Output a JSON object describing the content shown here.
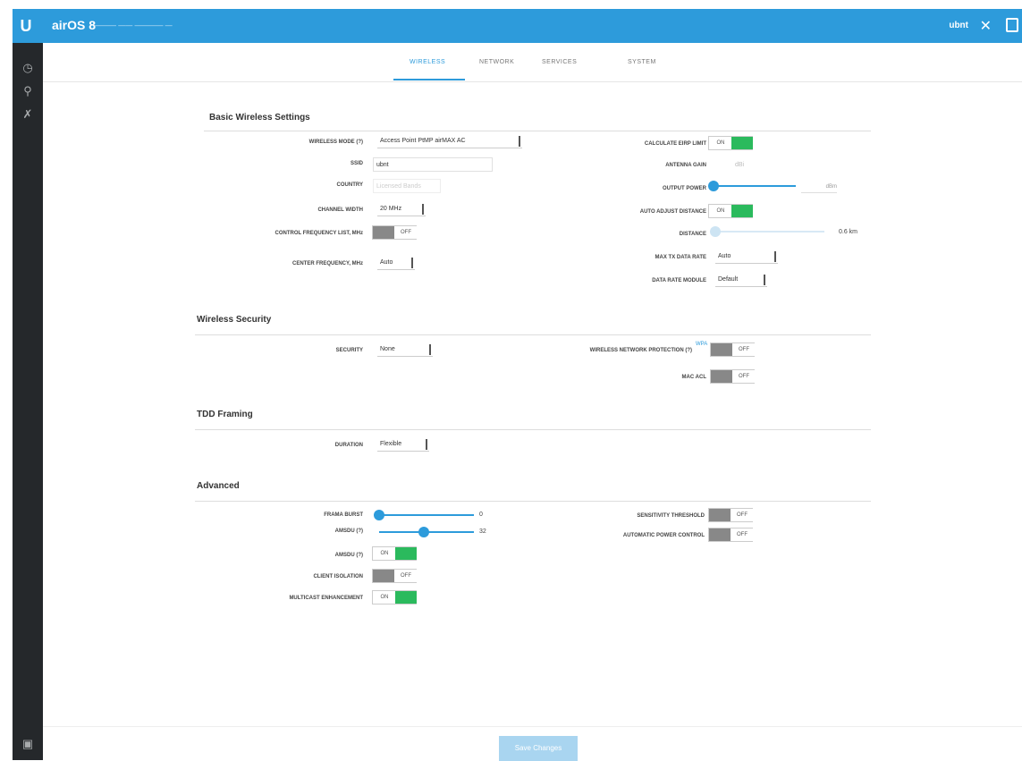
{
  "header": {
    "logo": "U",
    "brand": "airOS 8",
    "subtitle": "——— —— ———— —",
    "user": "ubnt",
    "tool_icon": "tools-icon",
    "logout_icon": "logout-icon"
  },
  "sidebar": {
    "items": [
      {
        "icon": "dashboard-icon",
        "glyph": "◷"
      },
      {
        "icon": "search-icon",
        "glyph": "⚲"
      },
      {
        "icon": "wrench-icon",
        "glyph": "✗"
      }
    ],
    "bottom_icon": "support-icon"
  },
  "tabs": [
    {
      "label": "WIRELESS",
      "active": true
    },
    {
      "label": "NETWORK",
      "active": false
    },
    {
      "label": "SERVICES",
      "active": false
    },
    {
      "label": "SYSTEM",
      "active": false
    }
  ],
  "basic": {
    "title": "Basic Wireless Settings",
    "wireless_mode_label": "WIRELESS MODE (?)",
    "wireless_mode_value": "Access Point PtMP airMAX AC",
    "ssid_label": "SSID",
    "ssid_value": "ubnt",
    "country_label": "COUNTRY",
    "country_value": "Licensed Bands",
    "channel_width_label": "CHANNEL WIDTH",
    "channel_width_value": "20 MHz",
    "control_freq_label": "CONTROL FREQUENCY LIST, MHz",
    "control_freq_state": "OFF",
    "center_freq_label": "CENTER FREQUENCY, MHz",
    "center_freq_value": "Auto",
    "calc_eirp_label": "CALCULATE EIRP LIMIT",
    "calc_eirp_state": "ON",
    "antenna_gain_label": "ANTENNA GAIN",
    "antenna_gain_value": "dBi",
    "output_power_label": "OUTPUT POWER",
    "output_power_value": "dBm",
    "auto_adjust_label": "AUTO ADJUST DISTANCE",
    "auto_adjust_state": "ON",
    "distance_label": "DISTANCE",
    "distance_value": "0.6 km",
    "max_tx_label": "MAX TX DATA RATE",
    "max_tx_value": "Auto",
    "data_rate_module_label": "DATA RATE MODULE",
    "data_rate_module_value": "Default"
  },
  "security": {
    "title": "Wireless Security",
    "security_label": "SECURITY",
    "security_value": "None",
    "wnp_label": "WIRELESS NETWORK PROTECTION (?)",
    "wnp_help": "WPA",
    "wnp_state": "OFF",
    "mac_acl_label": "MAC ACL",
    "mac_acl_state": "OFF"
  },
  "tdd": {
    "title": "TDD Framing",
    "duration_label": "DURATION",
    "duration_value": "Flexible"
  },
  "advanced": {
    "title": "Advanced",
    "rssi_label": "FRAMA BURST",
    "rssi_value": "0",
    "ampdu_label": "AMSDU (?)",
    "ampdu_value": "32",
    "amsdu_label": "AMSDU (?)",
    "amsdu_state": "ON",
    "client_isolation_label": "CLIENT ISOLATION",
    "client_isolation_state": "OFF",
    "multicast_label": "MULTICAST ENHANCEMENT",
    "multicast_state": "ON",
    "sensitivity_label": "SENSITIVITY THRESHOLD",
    "sensitivity_state": "OFF",
    "apc_label": "AUTOMATIC POWER CONTROL",
    "apc_state": "OFF"
  },
  "footer": {
    "save_label": "Save Changes"
  },
  "colors": {
    "accent": "#2d9bdb",
    "sidebar": "#25282b",
    "toggle_on": "#2bba5d",
    "toggle_off": "#888888"
  }
}
